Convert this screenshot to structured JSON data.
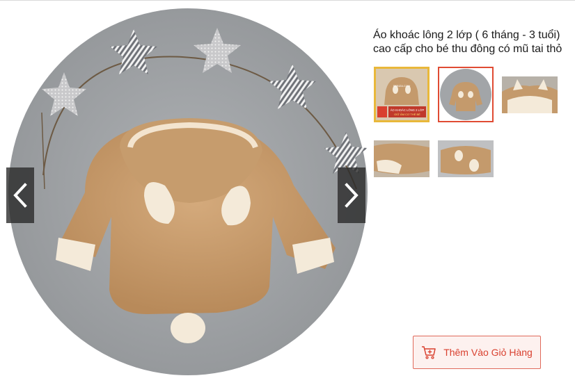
{
  "product": {
    "title": "Áo khoác lông 2 lớp ( 6 tháng - 3 tuổi) cao cấp cho bé thu đông có mũ tai thỏ"
  },
  "gallery": {
    "prev_icon": "chevron-left-icon",
    "next_icon": "chevron-right-icon",
    "thumb1_caption_line1": "ÁO KHOÁC LÔNG 2 LỚP",
    "thumb1_caption_line2": "GIỮ ẤM CƠ THỂ BÉ",
    "thumb1_watermark": "SEBIZA.COM",
    "selected_thumbnail": 2
  },
  "cart": {
    "label": "Thêm Vào Giỏ Hàng",
    "icon": "cart-plus-icon"
  },
  "colors": {
    "accent": "#e04b33",
    "coat": "#c49a6c",
    "backdrop": "#9fa2a5"
  }
}
